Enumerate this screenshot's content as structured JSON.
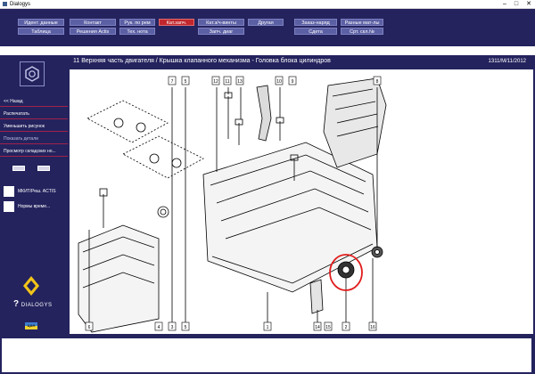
{
  "window": {
    "title": "Dialogys",
    "minimize": "–",
    "maximize": "□",
    "close": "✕"
  },
  "menu": {
    "row1": [
      "Идент. данные",
      "Контакт",
      "Рук. по рем",
      "Кат.запч.",
      "Кат.з/ч-винты",
      "Другая",
      "Заказ-наряд",
      "Разные мат-лы"
    ],
    "row2": [
      "Таблица",
      "Решения Actis",
      "Тех. нота",
      "Запч. диаг",
      "Сдета",
      "Срт. скл.№"
    ],
    "active": "Кат.запч."
  },
  "sidebar": {
    "items": [
      "<< Назад",
      "Распечатать",
      "Уменьшить рисунок",
      "Показать детали",
      "Просмотр складских но..."
    ],
    "icon_items": [
      "МКИТ/Реш. ACTIS",
      "Нормы време..."
    ],
    "brand": "DIALOGYS",
    "lang": "ЦАН"
  },
  "main": {
    "title": "11 Верхняя часть двигателя / Крышка клапанного механизма - Головка блока цилиндров",
    "code": "1311/M/11/2012"
  },
  "diagram": {
    "labels": [
      "12",
      "11",
      "13",
      "10",
      "7",
      "5",
      "8",
      "6",
      "1",
      "5",
      "2",
      "16",
      "14",
      "3",
      "4",
      "9",
      "15"
    ]
  },
  "colors": {
    "menu_bg": "#24235e",
    "button": "#5b5fa3",
    "active": "#c1272d",
    "highlight_circle": "#e01b1b"
  }
}
